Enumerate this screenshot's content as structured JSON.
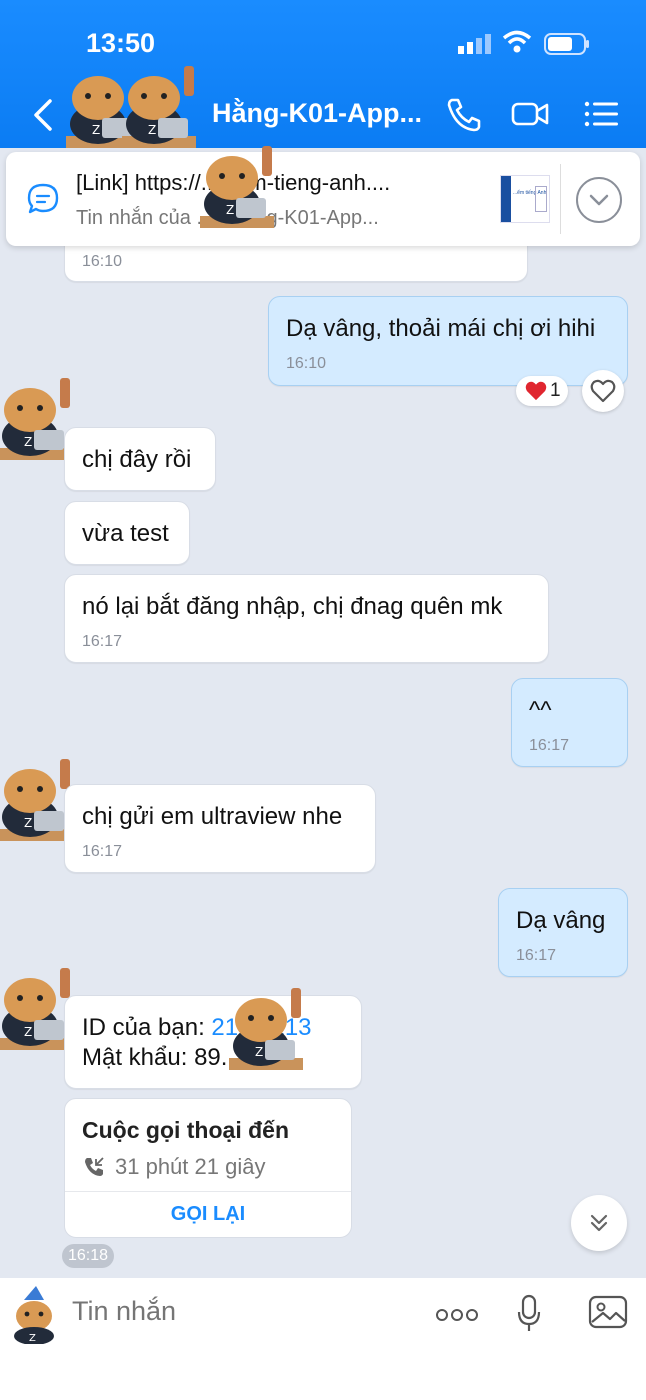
{
  "status": {
    "time": "13:50"
  },
  "header": {
    "title": "Hằng-K01-App..."
  },
  "pinned": {
    "line1": "[Link] https://...diem-tieng-anh....",
    "line2": "Tin nhắn của ...u Hằng-K01-App...",
    "thumb_text": "...ểm tiếng Anh"
  },
  "messages": {
    "m0_time": "16:10",
    "m1_text": "Dạ vâng, thoải mái chị ơi hihi",
    "m1_time": "16:10",
    "m1_reaction_count": "1",
    "m2_text": "chị đây rồi",
    "m3_text": "vừa test",
    "m4_text": "nó lại bắt đăng nhập, chị đnag quên mk",
    "m4_time": "16:17",
    "m5_text": "^^",
    "m5_time": "16:17",
    "m6_text": "chị gửi em ultraview nhe",
    "m6_time": "16:17",
    "m7_text": "Dạ vâng",
    "m7_time": "16:17",
    "m8_id_label": "ID của bạn:",
    "m8_id_value": "21...5213",
    "m8_pw_label": "Mật khẩu:",
    "m8_pw_value": "89..."
  },
  "call": {
    "title": "Cuộc gọi thoại đến",
    "duration": "31 phút 21 giây",
    "callback_label": "GỌI LẠI"
  },
  "time_chip": "16:18",
  "composer": {
    "placeholder": "Tin nhắn"
  },
  "colors": {
    "header": "#1a8cff",
    "outgoing": "#d4ebff",
    "incoming": "#ffffff",
    "background": "#e3e8f1"
  }
}
